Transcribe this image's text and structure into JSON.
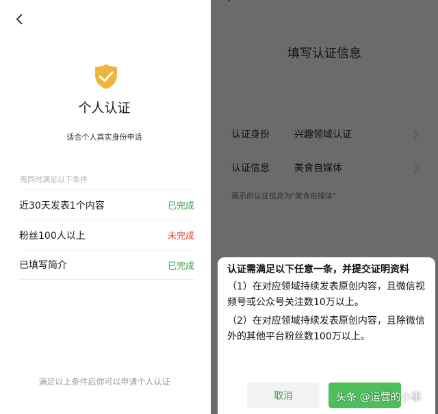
{
  "left": {
    "title": "个人认证",
    "subtitle": "适合个人真实身份申请",
    "section_label": "需同时满足以下条件",
    "conditions": [
      {
        "name": "近30天发表1个内容",
        "status": "已完成"
      },
      {
        "name": "粉丝100人以上",
        "status": "未完成"
      },
      {
        "name": "已填写简介",
        "status": "已完成"
      }
    ],
    "footer_note": "满足以上条件后你可以申请个人认证"
  },
  "right": {
    "title": "填写认证信息",
    "rows": [
      {
        "key": "认证身份",
        "value": "兴趣领域认证"
      },
      {
        "key": "认证信息",
        "value": "美食自媒体"
      }
    ],
    "hint": "展示的认证信息为\"美食自媒体\""
  },
  "dialog": {
    "heading": "认证需满足以下任意一条，并提交证明资料",
    "items": [
      "（1）在对应领域持续发表原创内容，且微信视频号或公众号关注数10万以上。",
      "（2）在对应领域持续发表原创内容，且除微信外的其他平台粉丝数100万以上。"
    ],
    "cancel_label": "取消",
    "confirm_label": ""
  },
  "watermark": "头条 @运营的小事",
  "colors": {
    "shield": "#f0b43c",
    "done": "#39a04a",
    "todo": "#e0422a",
    "confirm_button": "#4cbf5b",
    "overlay": "#6b6b6b"
  },
  "icons": [
    "back-arrow-icon",
    "shield-check-icon",
    "chevron-right-icon"
  ]
}
